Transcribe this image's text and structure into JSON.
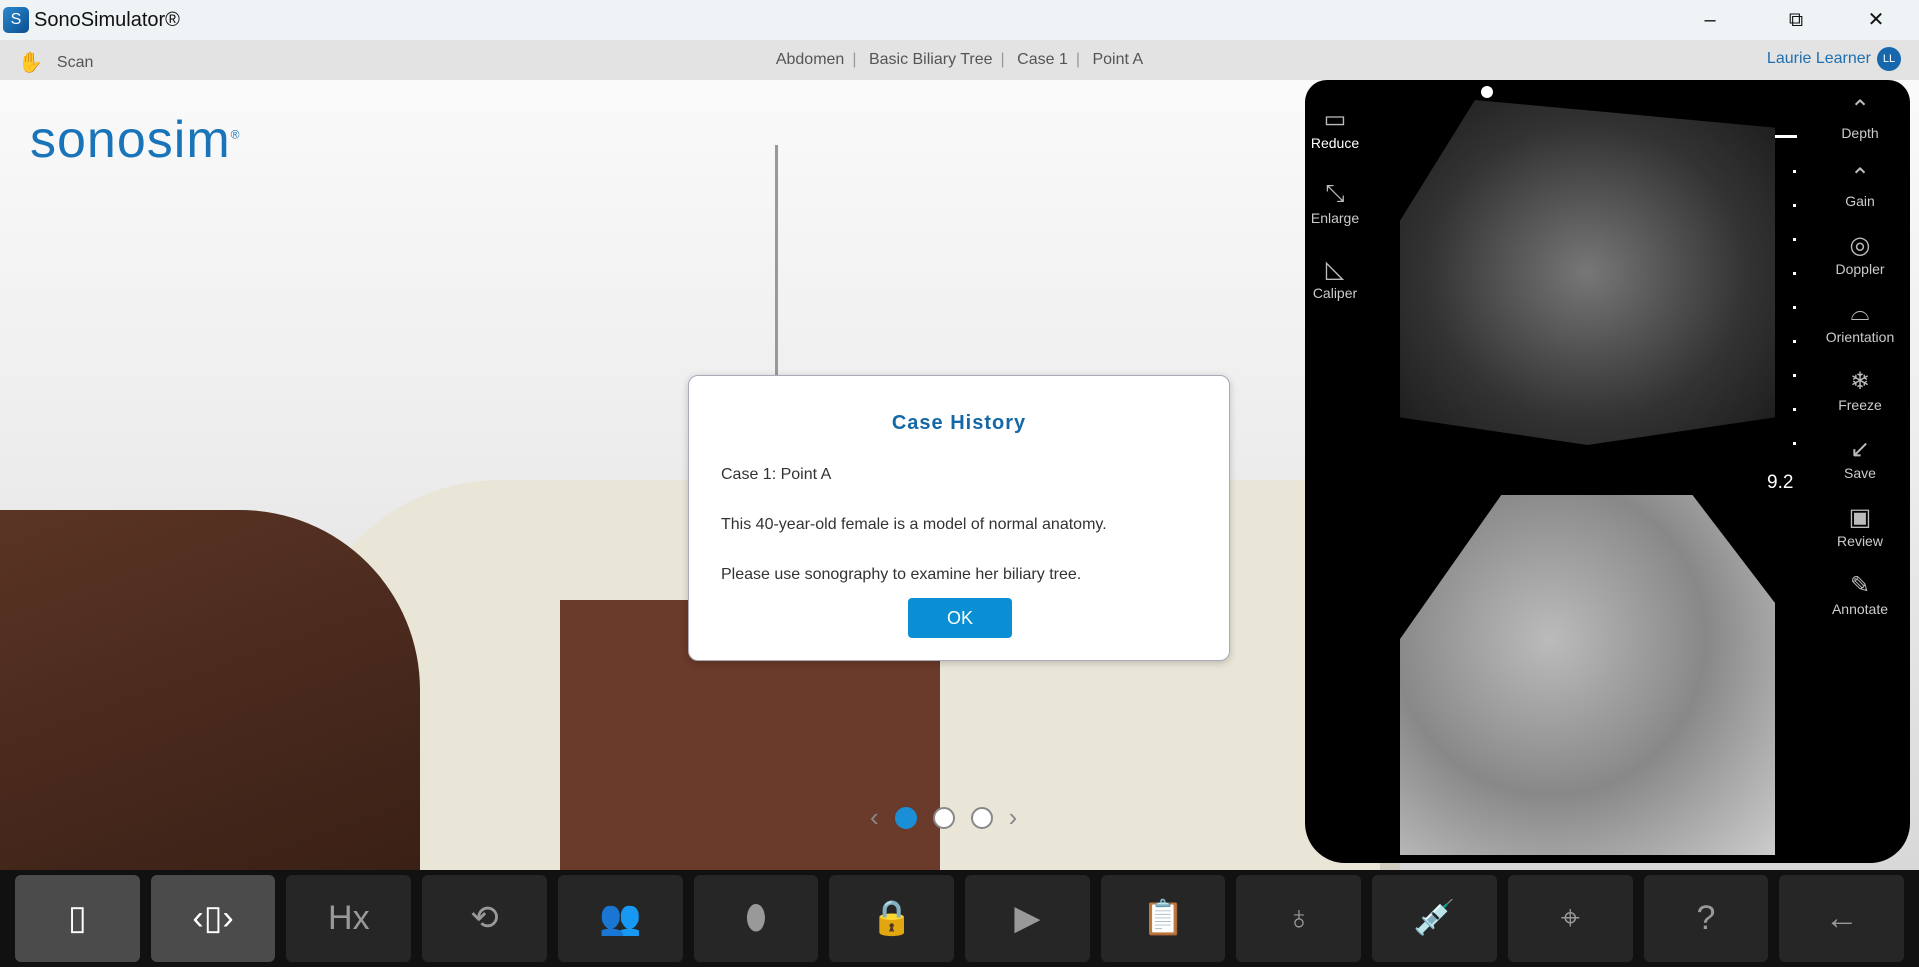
{
  "window": {
    "title": "SonoSimulator®",
    "minimize": "–",
    "restore": "⧉",
    "close": "✕"
  },
  "header": {
    "mode": "Scan",
    "breadcrumb": [
      "Abdomen",
      "Basic Biliary Tree",
      "Case 1",
      "Point A"
    ],
    "user": "Laurie Learner",
    "user_initials": "LL"
  },
  "logo": {
    "text": "sonosim",
    "mark": "®"
  },
  "ultrasound": {
    "left_tools": [
      {
        "label": "Reduce",
        "icon": "reduce-icon",
        "glyph": "▭"
      },
      {
        "label": "Enlarge",
        "icon": "enlarge-icon",
        "glyph": "⤡"
      },
      {
        "label": "Caliper",
        "icon": "caliper-icon",
        "glyph": "◺"
      }
    ],
    "right_tools": [
      {
        "label": "Depth",
        "icon": "depth-icon",
        "glyph": "⌃"
      },
      {
        "label": "Gain",
        "icon": "gain-icon",
        "glyph": "⌃"
      },
      {
        "label": "Doppler",
        "icon": "doppler-icon",
        "glyph": "◎"
      },
      {
        "label": "Orientation",
        "icon": "orientation-icon",
        "glyph": "⌓"
      },
      {
        "label": "Freeze",
        "icon": "freeze-icon",
        "glyph": "❄"
      },
      {
        "label": "Save",
        "icon": "save-icon",
        "glyph": "↙"
      },
      {
        "label": "Review",
        "icon": "review-icon",
        "glyph": "▣"
      },
      {
        "label": "Annotate",
        "icon": "annotate-icon",
        "glyph": "✎"
      }
    ],
    "depth_value": "9.2"
  },
  "dialog": {
    "title": "Case History",
    "case": "Case 1: Point A",
    "line1": "This 40-year-old female is a model of normal anatomy.",
    "line2": "Please use sonography to examine her biliary tree.",
    "ok": "OK"
  },
  "carousel": {
    "prev": "‹",
    "next": "›",
    "count": 3,
    "active": 1
  },
  "toolbar": [
    {
      "icon": "probe-views-icon",
      "glyph": "▯",
      "active": true
    },
    {
      "icon": "probe-switch-icon",
      "glyph": "‹▯›",
      "active": true
    },
    {
      "icon": "history-icon",
      "glyph": "Hx"
    },
    {
      "icon": "patient-position-icon",
      "glyph": "⟲"
    },
    {
      "icon": "patients-icon",
      "glyph": "👥"
    },
    {
      "icon": "probe-icon",
      "glyph": "⬮"
    },
    {
      "icon": "lock-icon",
      "glyph": "🔒"
    },
    {
      "icon": "play-icon",
      "glyph": "▶"
    },
    {
      "icon": "assessment-icon",
      "glyph": "📋"
    },
    {
      "icon": "transducer-icon",
      "glyph": "♁"
    },
    {
      "icon": "syringe-icon",
      "glyph": "💉"
    },
    {
      "icon": "target-icon",
      "glyph": "⌖"
    },
    {
      "icon": "help-icon",
      "glyph": "?"
    },
    {
      "icon": "exit-icon",
      "glyph": "←"
    }
  ]
}
